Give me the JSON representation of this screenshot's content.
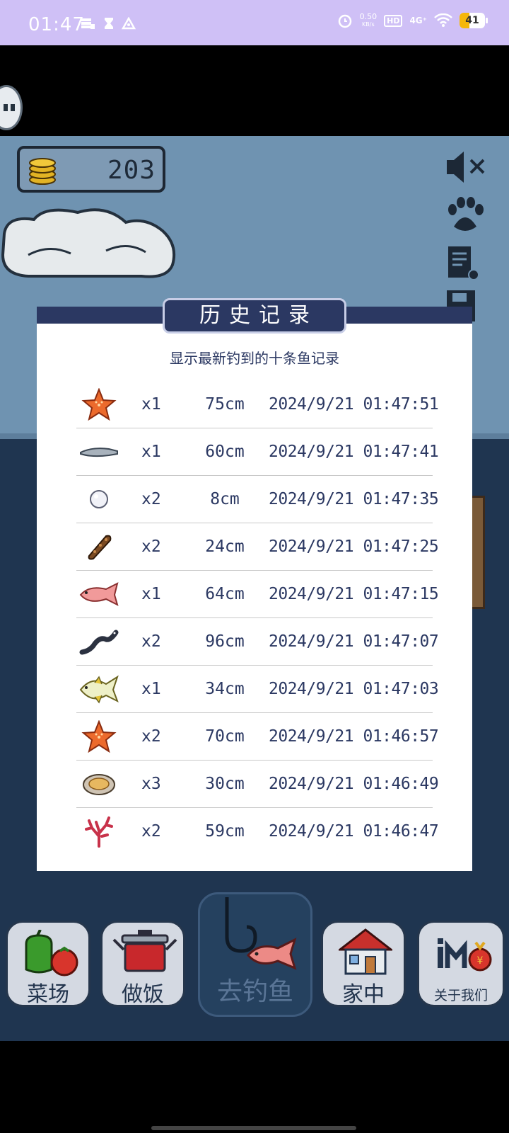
{
  "status_bar": {
    "time": "01:47",
    "net_speed": "0.50",
    "net_unit": "KB/s",
    "hd": "HD",
    "signal": "4G⁺",
    "battery": "41"
  },
  "coins": {
    "value": "203"
  },
  "dialog": {
    "title": "历史记录",
    "subtitle": "显示最新钓到的十条鱼记录",
    "records": [
      {
        "icon": "starfish-icon",
        "count": "x1",
        "size": "75cm",
        "time": "2024/9/21 01:47:51"
      },
      {
        "icon": "eel-icon",
        "count": "x1",
        "size": "60cm",
        "time": "2024/9/21 01:47:41"
      },
      {
        "icon": "pearl-icon",
        "count": "x2",
        "size": "8cm",
        "time": "2024/9/21 01:47:35"
      },
      {
        "icon": "sea-cucumber-icon",
        "count": "x2",
        "size": "24cm",
        "time": "2024/9/21 01:47:25"
      },
      {
        "icon": "red-snapper-icon",
        "count": "x1",
        "size": "64cm",
        "time": "2024/9/21 01:47:15"
      },
      {
        "icon": "black-eel-icon",
        "count": "x2",
        "size": "96cm",
        "time": "2024/9/21 01:47:07"
      },
      {
        "icon": "pompano-icon",
        "count": "x1",
        "size": "34cm",
        "time": "2024/9/21 01:47:03"
      },
      {
        "icon": "starfish-icon",
        "count": "x2",
        "size": "70cm",
        "time": "2024/9/21 01:46:57"
      },
      {
        "icon": "abalone-icon",
        "count": "x3",
        "size": "30cm",
        "time": "2024/9/21 01:46:49"
      },
      {
        "icon": "coral-icon",
        "count": "x2",
        "size": "59cm",
        "time": "2024/9/21 01:46:47"
      }
    ]
  },
  "bottom_nav": {
    "farm": "菜场",
    "cook": "做饭",
    "fishing": "去钓鱼",
    "home": "家中",
    "about": "关于我们"
  },
  "colors": {
    "dialog_header": "#2b3862",
    "sky": "#6f93b1",
    "sea": "#1f3550",
    "status_bar": "#cfc0f6"
  }
}
